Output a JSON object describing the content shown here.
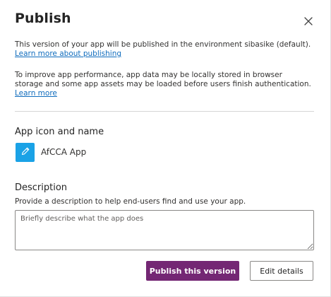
{
  "dialog": {
    "title": "Publish"
  },
  "info": {
    "environment_text": "This version of your app will be published in the environment sibasike (default).",
    "environment_link": "Learn more about publishing",
    "performance_text": "To improve app performance, app data may be locally stored in browser storage and some app assets may be loaded before users finish authentication.",
    "performance_link": "Learn more"
  },
  "app_section": {
    "heading": "App icon and name",
    "app_name": "AfCCA App",
    "icon": "pencil-icon",
    "icon_color": "#1aa2e6"
  },
  "description_section": {
    "heading": "Description",
    "help_text": "Provide a description to help end-users find and use your app.",
    "value": "",
    "placeholder": "Briefly describe what the app does"
  },
  "actions": {
    "publish_label": "Publish this version",
    "edit_label": "Edit details",
    "primary_color": "#742774"
  }
}
